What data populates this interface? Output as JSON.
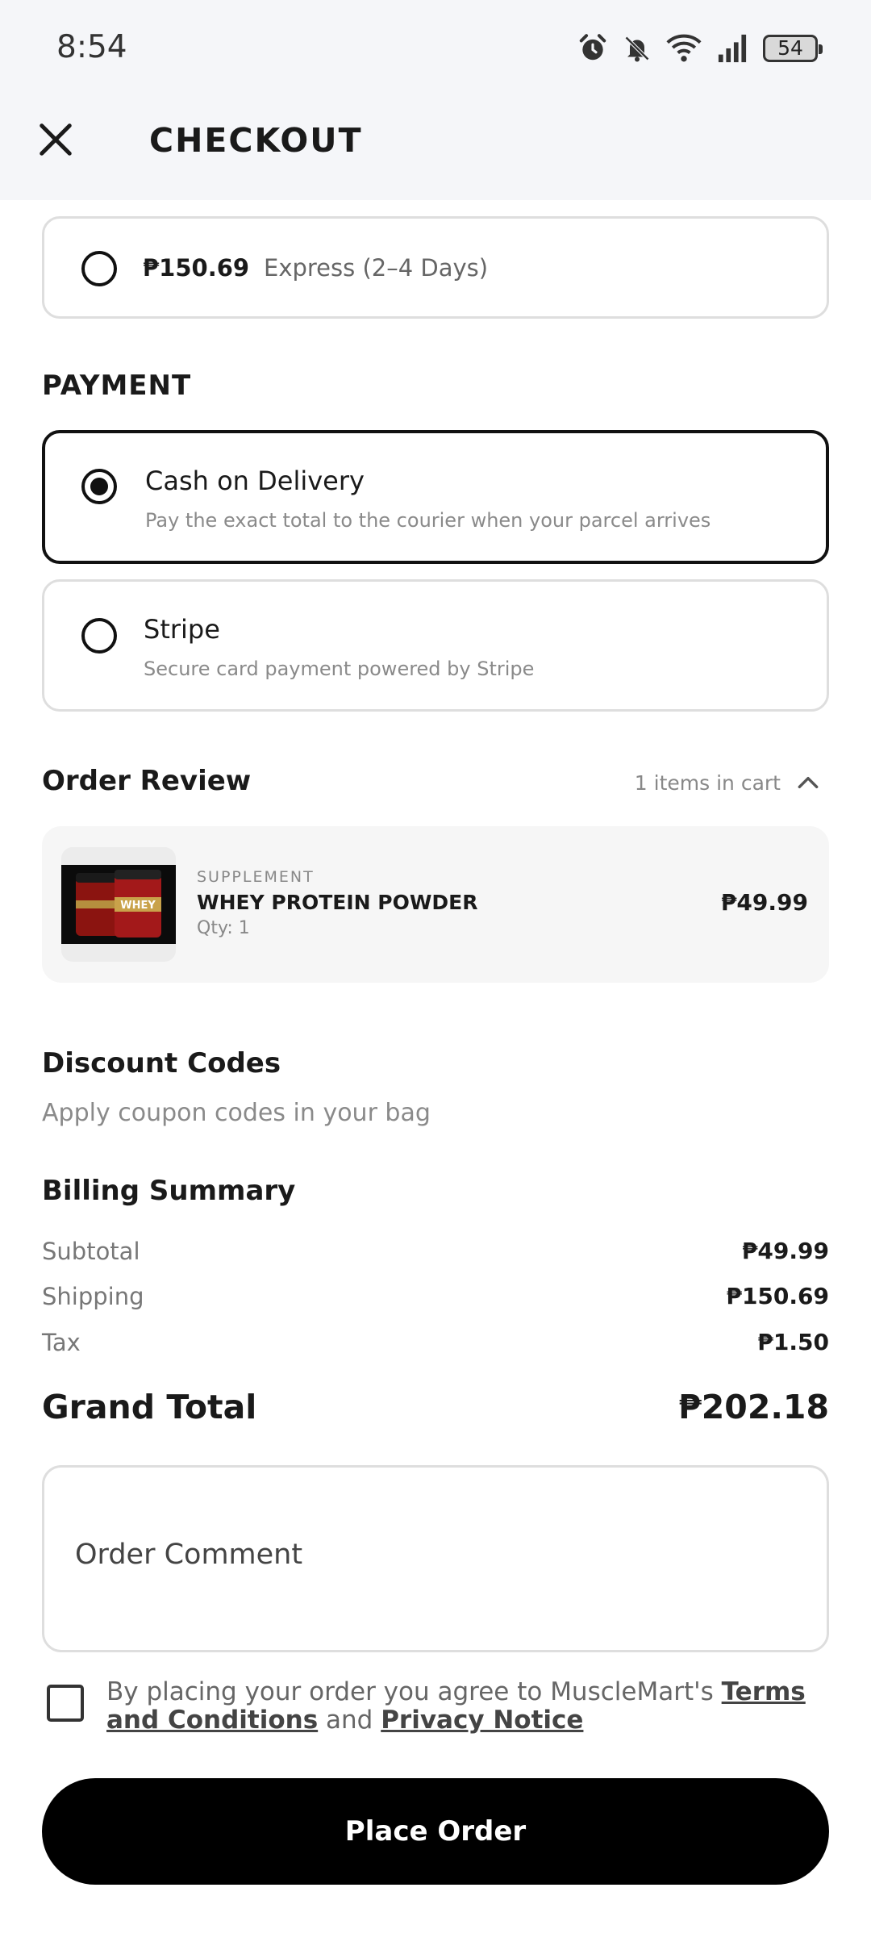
{
  "status_bar": {
    "time": "8:54",
    "battery": "54",
    "icons": [
      "alarm-icon",
      "bell-muted-icon",
      "wifi-icon",
      "signal-icon",
      "battery-icon"
    ]
  },
  "header": {
    "title": "CHECKOUT",
    "close_icon": "close-icon"
  },
  "shipping_option": {
    "price": "₱150.69",
    "description": "Express (2–4 Days)",
    "selected": false
  },
  "payment": {
    "heading": "PAYMENT",
    "methods": [
      {
        "title": "Cash on Delivery",
        "subtitle": "Pay the exact total to the courier when your parcel arrives",
        "selected": true
      },
      {
        "title": "Stripe",
        "subtitle": "Secure card payment powered by Stripe",
        "selected": false
      }
    ]
  },
  "order_review": {
    "heading": "Order Review",
    "items_count": "1 items in cart",
    "items": [
      {
        "category": "SUPPLEMENT",
        "name": "WHEY PROTEIN POWDER",
        "qty": "Qty: 1",
        "price": "₱49.99",
        "thumb_text": "WHEY"
      }
    ]
  },
  "discount": {
    "heading": "Discount Codes",
    "subtitle": "Apply coupon codes in your bag"
  },
  "billing": {
    "heading": "Billing Summary",
    "rows": [
      {
        "label": "Subtotal",
        "value": "₱49.99"
      },
      {
        "label": "Shipping",
        "value": "₱150.69"
      },
      {
        "label": "Tax",
        "value": "₱1.50"
      }
    ],
    "grand_total_label": "Grand Total",
    "grand_total_value": "₱202.18"
  },
  "order_comment": {
    "placeholder": "Order Comment",
    "value": ""
  },
  "terms": {
    "prefix": "By placing your order you agree to MuscleMart's ",
    "terms_link": "Terms and Conditions",
    "middle": " and ",
    "privacy_link": "Privacy Notice",
    "checked": false
  },
  "place_order": {
    "label": "Place Order"
  },
  "colors": {
    "header_bg": "#f5f6f9",
    "primary": "#000000",
    "card_border": "#dedede",
    "muted_text": "#8a8a8a"
  }
}
